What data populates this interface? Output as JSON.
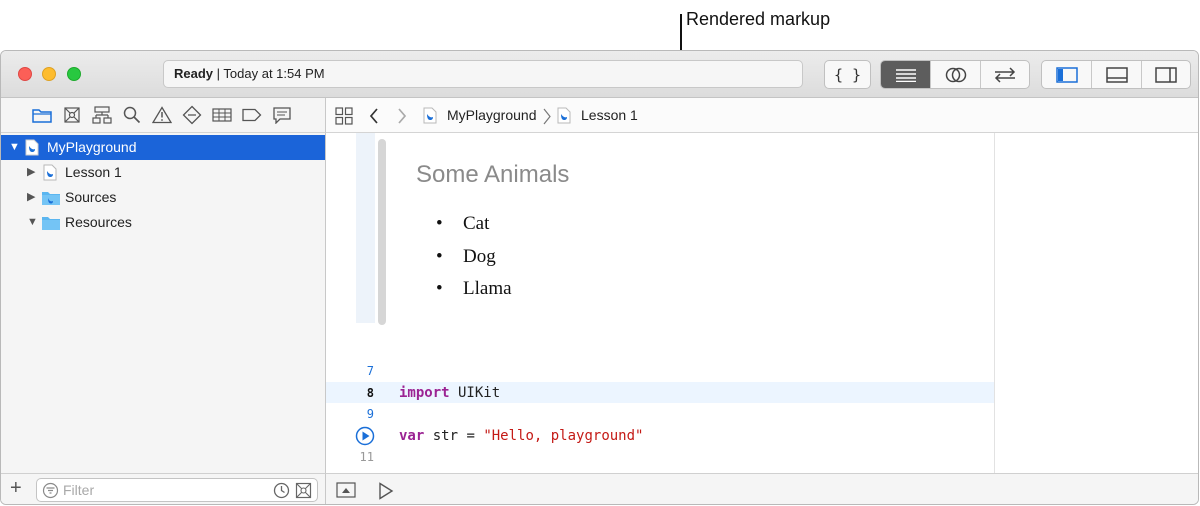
{
  "callout": {
    "label": "Rendered markup"
  },
  "toolbar": {
    "status_ready": "Ready",
    "status_separator": " | ",
    "status_time": "Today at 1:54 PM",
    "braces_label": "{ }"
  },
  "sidebar": {
    "items": [
      {
        "label": "MyPlayground",
        "kind": "swift-file",
        "expanded": true,
        "selected": true
      },
      {
        "label": "Lesson 1",
        "kind": "swift-file",
        "expanded": false
      },
      {
        "label": "Sources",
        "kind": "folder",
        "expanded": false
      },
      {
        "label": "Resources",
        "kind": "folder",
        "expanded": true
      }
    ],
    "filter_placeholder": "Filter"
  },
  "jumpbar": {
    "crumbs": [
      "MyPlayground",
      "Lesson 1"
    ]
  },
  "editor": {
    "markup_title": "Some Animals",
    "bullet_char": "•",
    "bullets": [
      "Cat",
      "Dog",
      "Llama"
    ],
    "lines": [
      {
        "num": "7",
        "keyword": "",
        "text": "",
        "string": ""
      },
      {
        "num": "8",
        "keyword": "import",
        "text": " UIKit",
        "string": ""
      },
      {
        "num": "9",
        "keyword": "",
        "text": "",
        "string": ""
      },
      {
        "num": "",
        "keyword": "var",
        "text": " str = ",
        "string": "\"Hello, playground\""
      },
      {
        "num": "11",
        "keyword": "",
        "text": "",
        "string": ""
      }
    ]
  },
  "colors": {
    "selection": "#1b64d9",
    "accent_icon": "#1a6fd8",
    "keyword": "#9b2393",
    "string": "#c41a16"
  }
}
